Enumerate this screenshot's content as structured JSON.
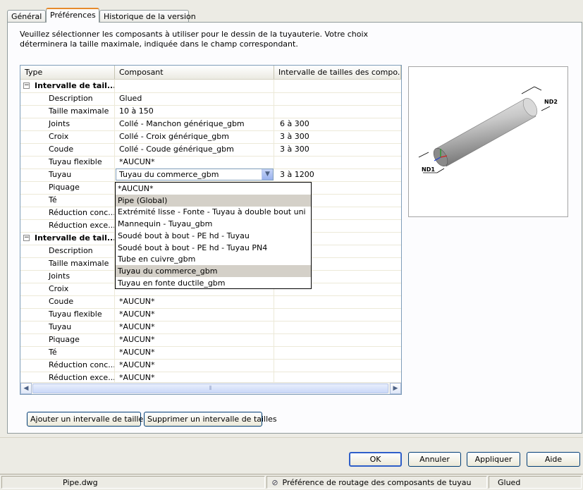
{
  "tabs": [
    {
      "label": "Général"
    },
    {
      "label": "Préférences"
    },
    {
      "label": "Historique de la version"
    }
  ],
  "description": "Veuillez sélectionner les composants à utiliser pour le dessin de la tuyauterie. Votre choix déterminera la taille maximale, indiquée dans le champ correspondant.",
  "grid": {
    "headers": {
      "type": "Type",
      "component": "Composant",
      "range": "Intervalle de tailles des compo..."
    },
    "rows": [
      {
        "type": "Intervalle de tail...",
        "component": "",
        "range": ""
      },
      {
        "type": "Description",
        "component": "Glued",
        "range": ""
      },
      {
        "type": "Taille maximale",
        "component": "10 à 150",
        "range": ""
      },
      {
        "type": "Joints",
        "component": "Collé - Manchon générique_gbm",
        "range": "6 à 300"
      },
      {
        "type": "Croix",
        "component": "Collé - Croix générique_gbm",
        "range": "3 à 300"
      },
      {
        "type": "Coude",
        "component": "Collé - Coude générique_gbm",
        "range": "3 à 300"
      },
      {
        "type": "Tuyau flexible",
        "component": "*AUCUN*",
        "range": ""
      },
      {
        "type": "Tuyau",
        "component": "Tuyau du commerce_gbm",
        "range": "3 à 1200"
      },
      {
        "type": "Piquage",
        "component": "",
        "range": ""
      },
      {
        "type": "Té",
        "component": "",
        "range": ""
      },
      {
        "type": "Réduction conc...",
        "component": "",
        "range": ""
      },
      {
        "type": "Réduction exce...",
        "component": "",
        "range": ""
      },
      {
        "type": "Intervalle de tail...",
        "component": "",
        "range": ""
      },
      {
        "type": "Description",
        "component": "",
        "range": ""
      },
      {
        "type": "Taille maximale",
        "component": "",
        "range": ""
      },
      {
        "type": "Joints",
        "component": "",
        "range": ""
      },
      {
        "type": "Croix",
        "component": "",
        "range": ""
      },
      {
        "type": "Coude",
        "component": "*AUCUN*",
        "range": ""
      },
      {
        "type": "Tuyau flexible",
        "component": "*AUCUN*",
        "range": ""
      },
      {
        "type": "Tuyau",
        "component": "*AUCUN*",
        "range": ""
      },
      {
        "type": "Piquage",
        "component": "*AUCUN*",
        "range": ""
      },
      {
        "type": "Té",
        "component": "*AUCUN*",
        "range": ""
      },
      {
        "type": "Réduction conc...",
        "component": "*AUCUN*",
        "range": ""
      },
      {
        "type": "Réduction exce...",
        "component": "*AUCUN*",
        "range": ""
      }
    ],
    "expander_symbol": "⊟"
  },
  "dropdown": {
    "selected": "Tuyau du commerce_gbm",
    "options": [
      "*AUCUN*",
      "Pipe (Global)",
      "Extrémité lisse - Fonte - Tuyau à double bout uni",
      "Mannequin - Tuyau_gbm",
      "Soudé bout à bout - PE hd - Tuyau",
      "Soudé bout à bout - PE hd - Tuyau PN4",
      "Tube en cuivre_gbm",
      "Tuyau du commerce_gbm",
      "Tuyau en fonte ductile_gbm"
    ]
  },
  "preview": {
    "label_nd1": "ND1",
    "label_nd2": "ND2"
  },
  "range_buttons": {
    "add": "Ajouter un intervalle de tailles",
    "remove": "Supprimer un intervalle de tailles"
  },
  "dialog_buttons": {
    "ok": "OK",
    "cancel": "Annuler",
    "apply": "Appliquer",
    "help": "Aide"
  },
  "statusbar": {
    "file": "Pipe.dwg",
    "message": "Préférence de routage des composants de tuyau",
    "value": "Glued"
  },
  "colors": {
    "tab_accent": "#e68b2c",
    "highlight": "#d4d0c8",
    "border_blue": "#7f9db9"
  }
}
